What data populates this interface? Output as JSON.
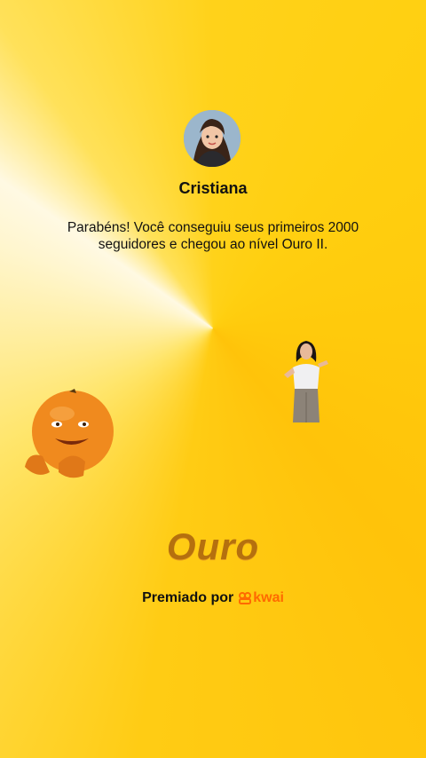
{
  "profile": {
    "name": "Cristiana"
  },
  "message": "Parabéns! Você conseguiu seus primeiros 2000 seguidores e chegou ao nível Ouro II.",
  "level": "Ouro",
  "award": {
    "prefix": "Premiado por",
    "brand": "kwai",
    "brand_color": "#ff6a00"
  },
  "colors": {
    "background": "#ffcc14",
    "level_text": "#b5700e"
  }
}
